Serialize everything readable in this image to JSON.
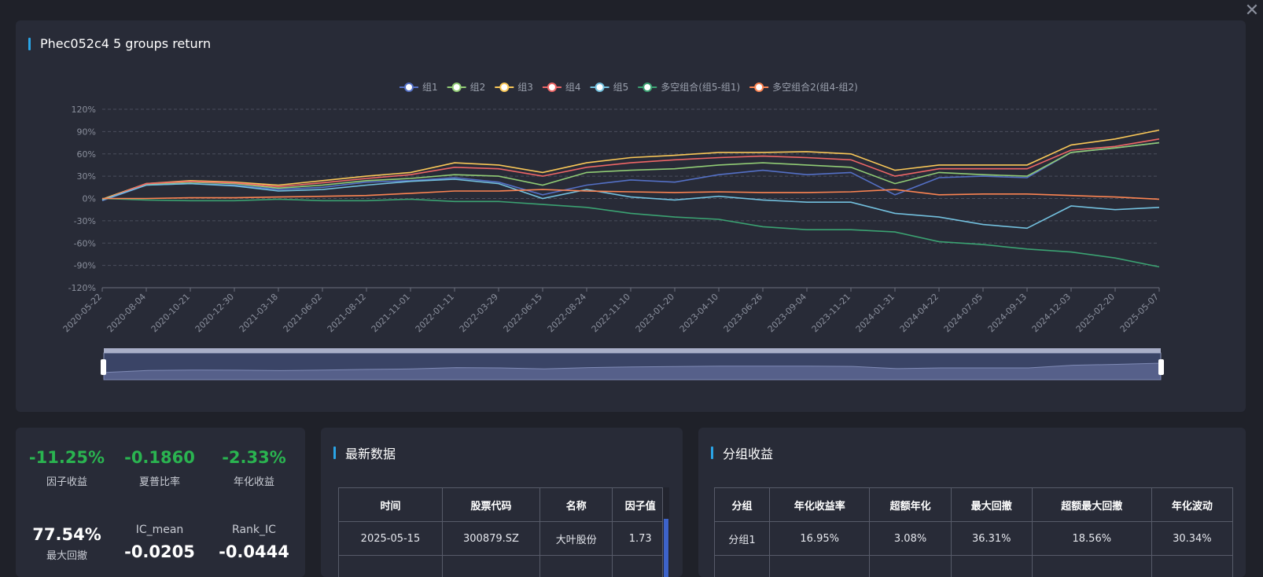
{
  "chart_panel": {
    "title": "Phec052c4 5 groups return"
  },
  "chart_data": {
    "type": "line",
    "title": "Phec052c4 5 groups return",
    "x_ticks": [
      "2020-05-22",
      "2020-08-04",
      "2020-10-21",
      "2020-12-30",
      "2021-03-18",
      "2021-06-02",
      "2021-08-12",
      "2021-11-01",
      "2022-01-11",
      "2022-03-29",
      "2022-06-15",
      "2022-08-24",
      "2022-11-10",
      "2023-01-20",
      "2023-04-10",
      "2023-06-26",
      "2023-09-04",
      "2023-11-21",
      "2024-01-31",
      "2024-04-22",
      "2024-07-05",
      "2024-09-13",
      "2024-12-03",
      "2025-02-20",
      "2025-05-07"
    ],
    "y_ticks": [
      "120%",
      "90%",
      "60%",
      "30%",
      "0%",
      "-30%",
      "-60%",
      "-90%",
      "-120%"
    ],
    "ylim": [
      -120,
      120
    ],
    "grid": true,
    "legend_position": "top-center",
    "series": [
      {
        "name": "组1",
        "color": "#5470c6",
        "values": [
          -3,
          18,
          20,
          18,
          12,
          15,
          22,
          24,
          28,
          22,
          5,
          18,
          25,
          22,
          32,
          38,
          32,
          35,
          5,
          28,
          30,
          28,
          62,
          68,
          75
        ]
      },
      {
        "name": "组2",
        "color": "#91cc75",
        "values": [
          -2,
          19,
          22,
          20,
          14,
          18,
          24,
          27,
          32,
          30,
          18,
          35,
          38,
          40,
          45,
          48,
          45,
          42,
          20,
          35,
          32,
          30,
          62,
          68,
          75
        ]
      },
      {
        "name": "组3",
        "color": "#fac858",
        "values": [
          -1,
          20,
          24,
          22,
          18,
          24,
          30,
          35,
          48,
          45,
          35,
          48,
          55,
          58,
          62,
          62,
          63,
          60,
          38,
          45,
          45,
          45,
          72,
          80,
          92
        ]
      },
      {
        "name": "组4",
        "color": "#ee6666",
        "values": [
          -2,
          20,
          23,
          21,
          16,
          21,
          27,
          32,
          42,
          40,
          30,
          42,
          48,
          52,
          55,
          57,
          55,
          52,
          30,
          40,
          40,
          40,
          65,
          70,
          80
        ]
      },
      {
        "name": "组5",
        "color": "#73c0de",
        "values": [
          -2,
          18,
          20,
          17,
          10,
          12,
          18,
          23,
          26,
          20,
          0,
          12,
          2,
          -2,
          3,
          -2,
          -5,
          -5,
          -20,
          -25,
          -35,
          -40,
          -10,
          -15,
          -12
        ]
      },
      {
        "name": "多空组合(组5-组1)",
        "color": "#3ba272",
        "values": [
          0,
          -2,
          -3,
          -3,
          -1,
          -3,
          -3,
          -1,
          -4,
          -4,
          -8,
          -12,
          -20,
          -25,
          -28,
          -38,
          -42,
          -42,
          -45,
          -58,
          -62,
          -68,
          -72,
          -80,
          -92
        ]
      },
      {
        "name": "多空组合2(组4-组2)",
        "color": "#fc8452",
        "values": [
          0,
          0,
          1,
          1,
          2,
          3,
          4,
          7,
          10,
          10,
          12,
          10,
          9,
          8,
          9,
          8,
          8,
          9,
          12,
          5,
          6,
          6,
          4,
          2,
          -1
        ]
      }
    ]
  },
  "stats": {
    "factor_return": {
      "value": "-11.25%",
      "label": "因子收益"
    },
    "sharpe": {
      "value": "-0.1860",
      "label": "夏普比率"
    },
    "annual_return": {
      "value": "-2.33%",
      "label": "年化收益"
    },
    "max_drawdown": {
      "value": "77.54%",
      "label": "最大回撤"
    },
    "ic_mean": {
      "label": "IC_mean",
      "value": "-0.0205"
    },
    "rank_ic": {
      "label": "Rank_IC",
      "value": "-0.0444"
    }
  },
  "latest": {
    "title": "最新数据",
    "headers": [
      "时间",
      "股票代码",
      "名称",
      "因子值"
    ],
    "rows": [
      [
        "2025-05-15",
        "300879.SZ",
        "大叶股份",
        "1.73"
      ]
    ]
  },
  "group_returns": {
    "title": "分组收益",
    "headers": [
      "分组",
      "年化收益率",
      "超额年化",
      "最大回撤",
      "超额最大回撤",
      "年化波动"
    ],
    "rows": [
      [
        "分组1",
        "16.95%",
        "3.08%",
        "36.31%",
        "18.56%",
        "30.34%"
      ]
    ]
  }
}
